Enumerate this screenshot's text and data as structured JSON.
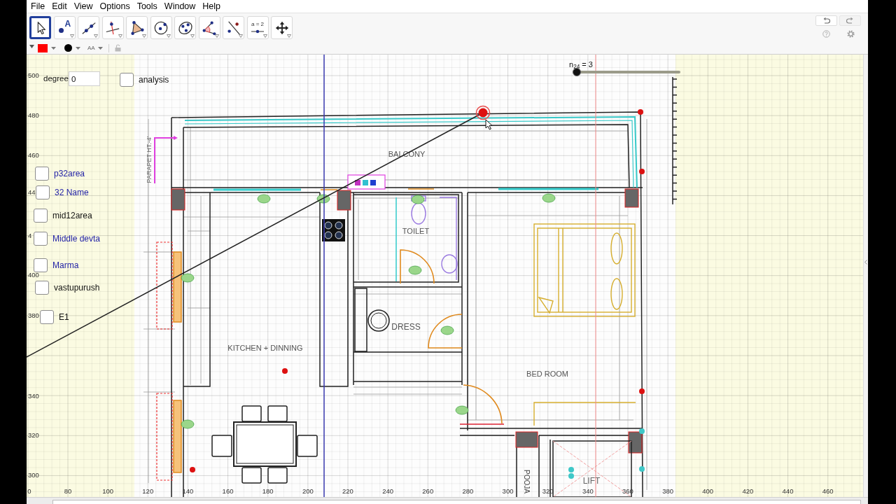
{
  "menu": [
    "File",
    "Edit",
    "View",
    "Options",
    "Tools",
    "Window",
    "Help"
  ],
  "toolbar": {
    "tools": [
      {
        "kind": "move",
        "selected": true
      },
      {
        "kind": "point",
        "text": "A",
        "selected": false
      },
      {
        "kind": "line",
        "selected": false
      },
      {
        "kind": "perpendicular",
        "selected": false
      },
      {
        "kind": "polygon",
        "selected": false
      },
      {
        "kind": "circle",
        "selected": false
      },
      {
        "kind": "conic",
        "selected": false
      },
      {
        "kind": "angle",
        "selected": false
      },
      {
        "kind": "reflect",
        "selected": false
      },
      {
        "kind": "slider",
        "text": "a = 2",
        "selected": false
      },
      {
        "kind": "pan",
        "selected": false
      }
    ],
    "style_bar": [
      {
        "kind": "toggle"
      },
      {
        "kind": "color",
        "color": "#ff0000"
      },
      {
        "kind": "point_style",
        "color": "#000000"
      },
      {
        "kind": "text_size",
        "text": "AA"
      },
      {
        "kind": "lock"
      }
    ]
  },
  "graphics": {
    "degree_field": {
      "label": "degree",
      "value": "0"
    },
    "checkboxes": [
      {
        "label": "analysis",
        "checked": false,
        "color": "#111111"
      },
      {
        "label": "p32area",
        "checked": false,
        "color": "#2323a6"
      },
      {
        "label": "32 Name",
        "checked": false,
        "color": "#2323a6"
      },
      {
        "label": "mid12area",
        "checked": false,
        "color": "#111111"
      },
      {
        "label": "Middle devta",
        "checked": false,
        "color": "#2323a6"
      },
      {
        "label": "Marma",
        "checked": false,
        "color": "#2323a6"
      },
      {
        "label": "vastupurush",
        "checked": false,
        "color": "#111111"
      },
      {
        "label": "E1",
        "checked": false,
        "color": "#111111"
      }
    ],
    "slider": {
      "label": "n$_{24}$ = 3",
      "level": 0
    },
    "y_axis_labels": [
      "500",
      "480",
      "460",
      "44",
      "4",
      "400",
      "380",
      "340",
      "320",
      "300"
    ],
    "x_axis_labels": [
      "0",
      "80",
      "100",
      "120",
      "140",
      "160",
      "180",
      "200",
      "220",
      "240",
      "260",
      "280",
      "300",
      "320",
      "340",
      "360",
      "380",
      "400",
      "420",
      "440",
      "460"
    ],
    "points": [
      {
        "color": "#dd1111",
        "selected": true
      },
      {
        "color": "#dd1111",
        "selected": false
      },
      {
        "color": "#dd1111",
        "selected": false
      },
      {
        "color": "#dd1111",
        "selected": false
      },
      {
        "color": "#dd1111",
        "selected": false
      },
      {
        "color": "#dd1111",
        "selected": false
      },
      {
        "color": "#3fc8c8",
        "selected": false
      },
      {
        "color": "#3fc8c8",
        "selected": false
      },
      {
        "color": "#3fc8c8",
        "selected": false
      },
      {
        "color": "#3fc8c8",
        "selected": false
      }
    ],
    "floor_plan": {
      "labels": [
        {
          "text": "PARAPET HT.-4'",
          "kind": "vertical_up"
        },
        {
          "text": "BALCONY",
          "kind": "horizontal"
        },
        {
          "text": "TOILET",
          "kind": "horizontal"
        },
        {
          "text": "DRESS",
          "kind": "horizontal"
        },
        {
          "text": "KITCHEN + DINNING",
          "kind": "horizontal"
        },
        {
          "text": "BED ROOM",
          "kind": "horizontal"
        },
        {
          "text": "POOJA",
          "kind": "vertical_down"
        },
        {
          "text": "LIFT",
          "kind": "horizontal"
        }
      ]
    }
  }
}
